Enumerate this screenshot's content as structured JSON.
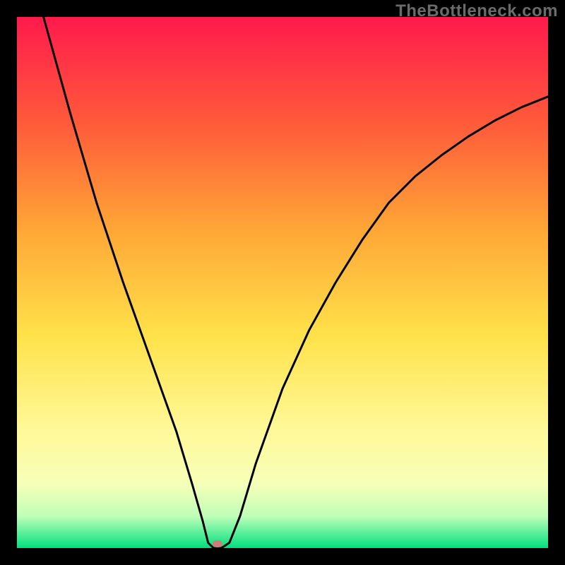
{
  "watermark": "TheBottleneck.com",
  "chart_data": {
    "type": "line",
    "x_fraction_range": [
      0,
      1
    ],
    "y_range_percent_bottleneck": [
      0,
      100
    ],
    "gradient_stops": [
      {
        "offset": 0.0,
        "color": "#ff1a4d"
      },
      {
        "offset": 0.2,
        "color": "#ff5a3a"
      },
      {
        "offset": 0.4,
        "color": "#ffa636"
      },
      {
        "offset": 0.6,
        "color": "#ffe24a"
      },
      {
        "offset": 0.78,
        "color": "#fff99a"
      },
      {
        "offset": 0.88,
        "color": "#f6ffb8"
      },
      {
        "offset": 0.94,
        "color": "#bfffb8"
      },
      {
        "offset": 1.0,
        "color": "#00e07e"
      }
    ],
    "curve_points": [
      {
        "x": 0.05,
        "y": 1.0
      },
      {
        "x": 0.1,
        "y": 0.82
      },
      {
        "x": 0.15,
        "y": 0.65
      },
      {
        "x": 0.2,
        "y": 0.5
      },
      {
        "x": 0.25,
        "y": 0.36
      },
      {
        "x": 0.3,
        "y": 0.22
      },
      {
        "x": 0.33,
        "y": 0.12
      },
      {
        "x": 0.35,
        "y": 0.05
      },
      {
        "x": 0.36,
        "y": 0.01
      },
      {
        "x": 0.37,
        "y": 0.0
      },
      {
        "x": 0.385,
        "y": 0.0
      },
      {
        "x": 0.4,
        "y": 0.01
      },
      {
        "x": 0.42,
        "y": 0.06
      },
      {
        "x": 0.45,
        "y": 0.16
      },
      {
        "x": 0.5,
        "y": 0.3
      },
      {
        "x": 0.55,
        "y": 0.41
      },
      {
        "x": 0.6,
        "y": 0.5
      },
      {
        "x": 0.65,
        "y": 0.58
      },
      {
        "x": 0.7,
        "y": 0.65
      },
      {
        "x": 0.75,
        "y": 0.7
      },
      {
        "x": 0.8,
        "y": 0.74
      },
      {
        "x": 0.85,
        "y": 0.775
      },
      {
        "x": 0.9,
        "y": 0.805
      },
      {
        "x": 0.95,
        "y": 0.83
      },
      {
        "x": 1.0,
        "y": 0.85
      }
    ],
    "optimum_marker": {
      "x": 0.378,
      "y": 0.008,
      "color": "#cf7c7a"
    },
    "title": "",
    "xlabel": "",
    "ylabel": ""
  }
}
